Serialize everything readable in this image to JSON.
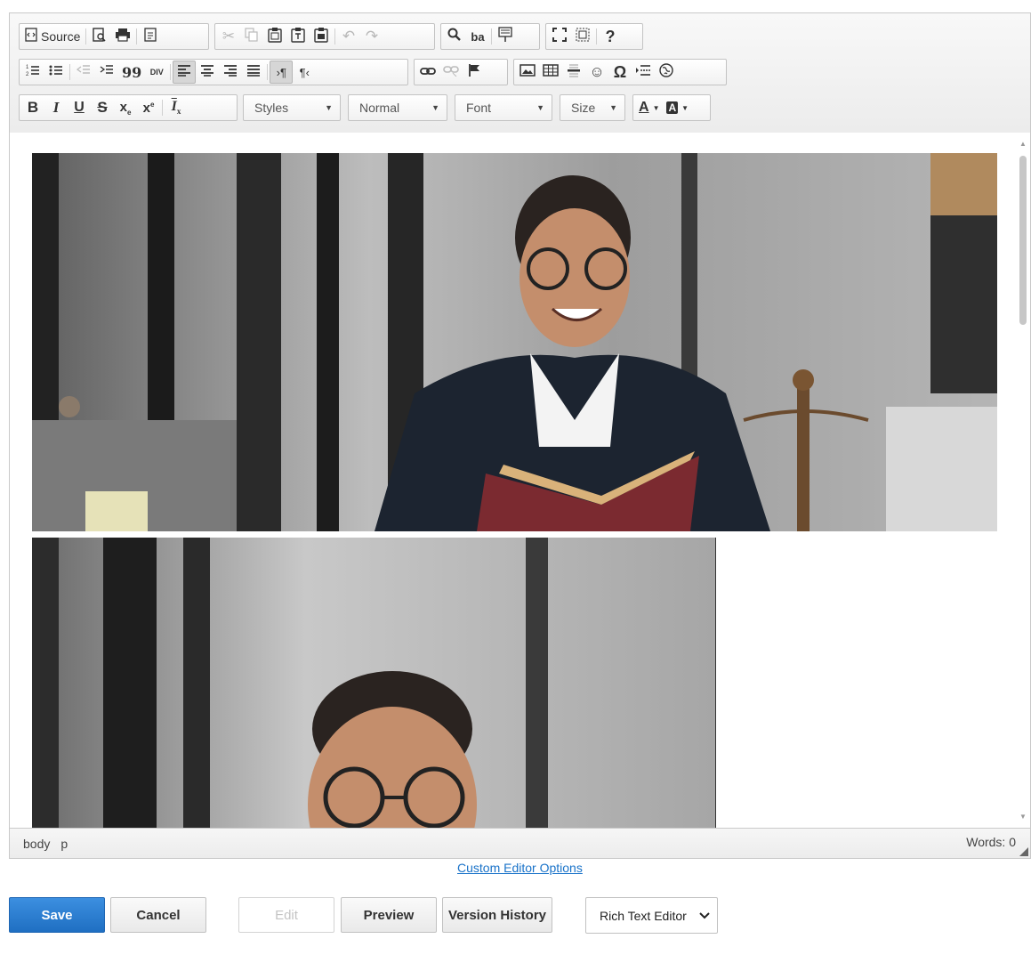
{
  "toolbar": {
    "source_label": "Source",
    "styles_label": "Styles",
    "format_label": "Normal",
    "font_label": "Font",
    "size_label": "Size",
    "help_label": "?",
    "omega_label": "Ω",
    "bold": "B",
    "italic": "I",
    "underline": "U",
    "strike": "S",
    "subscript": "x",
    "superscript": "x",
    "text_color": "A",
    "bg_color": "A",
    "removeformat": "I",
    "quote": "99",
    "div": "DIV"
  },
  "statusbar": {
    "path": [
      "body",
      "p"
    ],
    "words": "Words: 0"
  },
  "custom_options_link": "Custom Editor Options",
  "actions": {
    "save": "Save",
    "cancel": "Cancel",
    "edit": "Edit",
    "preview": "Preview",
    "version_history": "Version History"
  },
  "editor_mode": {
    "selected": "Rich Text Editor"
  },
  "icons": [
    "source-icon",
    "preview-icon",
    "print-icon",
    "templates-icon",
    "cut-icon",
    "copy-icon",
    "paste-icon",
    "paste-text-icon",
    "paste-word-icon",
    "undo-icon",
    "redo-icon",
    "find-icon",
    "replace-icon",
    "select-all-icon",
    "maximize-icon",
    "show-blocks-icon",
    "help-icon",
    "numbered-list-icon",
    "bulleted-list-icon",
    "outdent-icon",
    "indent-icon",
    "blockquote-icon",
    "create-div-icon",
    "align-left-icon",
    "align-center-icon",
    "align-right-icon",
    "justify-icon",
    "ltr-icon",
    "rtl-icon",
    "link-icon",
    "unlink-icon",
    "anchor-icon",
    "image-icon",
    "table-icon",
    "horizontal-rule-icon",
    "smiley-icon",
    "special-char-icon",
    "page-break-icon",
    "iframe-icon"
  ],
  "colors": {
    "primary_button": "#2a7bd1",
    "link": "#1a73c9",
    "toolbar_bg": "#f0f0f0"
  }
}
